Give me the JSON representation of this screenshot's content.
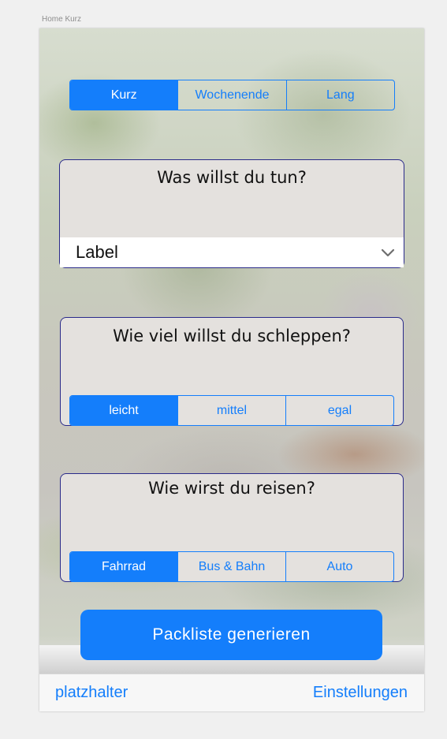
{
  "artboard": {
    "title": "Home Kurz"
  },
  "trip_length": {
    "segments": [
      "Kurz",
      "Wochenende",
      "Lang"
    ],
    "selected_index": 0
  },
  "activity_card": {
    "title": "Was willst du tun?",
    "dropdown_value": "Label",
    "dropdown_icon": "chevron-down-icon"
  },
  "weight_card": {
    "title": "Wie viel willst du schleppen?",
    "segments": [
      "leicht",
      "mittel",
      "egal"
    ],
    "selected_index": 0
  },
  "travel_card": {
    "title": "Wie wirst du reisen?",
    "segments": [
      "Fahrrad",
      "Bus & Bahn",
      "Auto"
    ],
    "selected_index": 0
  },
  "generate_button": {
    "label": "Packliste generieren"
  },
  "tabbar": {
    "left_label": "platzhalter",
    "right_label": "Einstellungen"
  },
  "colors": {
    "accent": "#147efb",
    "card_background": "#e4e1de",
    "card_border": "#2a2a8a"
  }
}
